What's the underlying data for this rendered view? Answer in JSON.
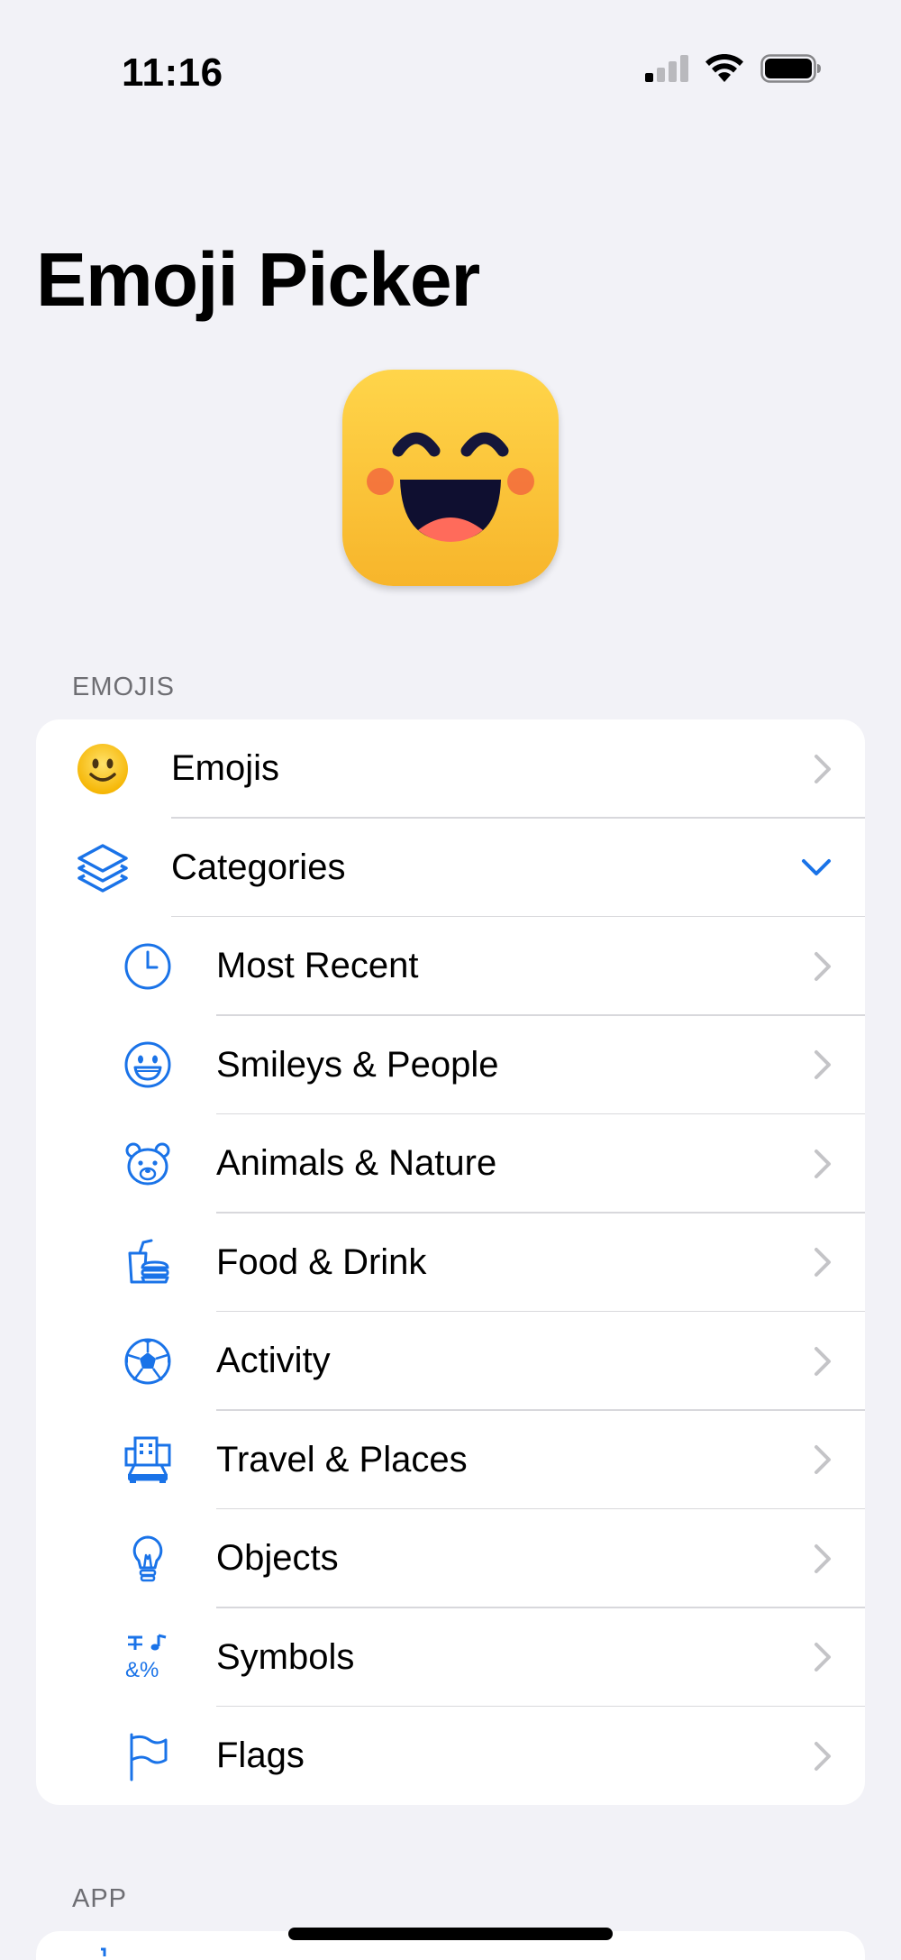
{
  "status_bar": {
    "time": "11:16"
  },
  "header": {
    "title": "Emoji Picker"
  },
  "sections": {
    "emojis_header": "EMOJIS",
    "app_header": "APP"
  },
  "rows": {
    "emojis": "Emojis",
    "categories": "Categories",
    "most_recent": "Most Recent",
    "smileys": "Smileys & People",
    "animals": "Animals & Nature",
    "food": "Food & Drink",
    "activity": "Activity",
    "travel": "Travel & Places",
    "objects": "Objects",
    "symbols": "Symbols",
    "flags": "Flags"
  },
  "colors": {
    "accent": "#1a73e8",
    "background": "#f2f2f7",
    "chevron": "#c4c4c7"
  }
}
